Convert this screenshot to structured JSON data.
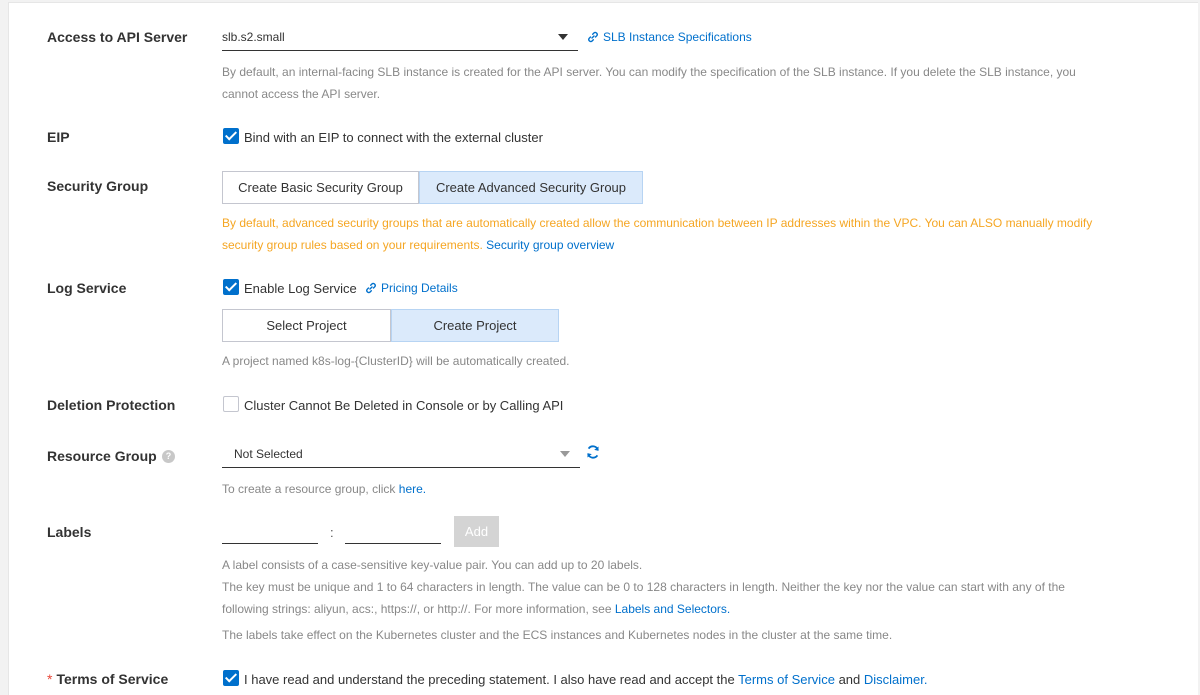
{
  "api_server": {
    "label": "Access to API Server",
    "select_value": "slb.s2.small",
    "spec_link": "SLB Instance Specifications",
    "help_line1": "By default, an internal-facing SLB instance is created for the API server. You can modify the specification of the SLB instance. If you delete the SLB instance, you",
    "help_line2": "cannot access the API server."
  },
  "eip": {
    "label": "EIP",
    "checked": true,
    "checkbox_label": "Bind with an EIP to connect with the external cluster"
  },
  "security_group": {
    "label": "Security Group",
    "basic_button": "Create Basic Security Group",
    "advanced_button": "Create Advanced Security Group",
    "warn_line1": "By default, advanced security groups that are automatically created allow the communication between IP addresses within the VPC. You can ALSO manually modify",
    "warn_line2": "security group rules based on your requirements.",
    "overview_link": "Security group overview"
  },
  "log_service": {
    "label": "Log Service",
    "checked": true,
    "checkbox_label": "Enable Log Service",
    "pricing_link": "Pricing Details",
    "select_project_button": "Select Project",
    "create_project_button": "Create Project",
    "help": "A project named k8s-log-{ClusterID} will be automatically created."
  },
  "deletion_protection": {
    "label": "Deletion Protection",
    "checked": false,
    "checkbox_label": "Cluster Cannot Be Deleted in Console or by Calling API"
  },
  "resource_group": {
    "label": "Resource Group",
    "select_value": "Not Selected",
    "help_prefix": "To create a resource group, click",
    "help_link": "here."
  },
  "labels": {
    "label": "Labels",
    "separator": ":",
    "add_button": "Add",
    "help_line1": "A label consists of a case-sensitive key-value pair. You can add up to 20 labels.",
    "help_line2": "The key must be unique and 1 to 64 characters in length. The value can be 0 to 128 characters in length. Neither the key nor the value can start with any of the",
    "help_line3": "following strings: aliyun, acs:, https://, or http://. For more information, see",
    "help_line3_link": "Labels and Selectors.",
    "help_line4": "The labels take effect on the Kubernetes cluster and the ECS instances and Kubernetes nodes in the cluster at the same time."
  },
  "terms": {
    "required_mark": "*",
    "label": "Terms of Service",
    "checked": true,
    "text_prefix": "I have read and understand the preceding statement. I also have read and accept the",
    "terms_link": "Terms of Service",
    "and": "and",
    "disclaimer_link": "Disclaimer."
  },
  "colors": {
    "link": "#0070cc",
    "warning": "#f5a623",
    "selected_button_bg": "#dbeafb",
    "checkbox_checked": "#0070cc"
  },
  "icons": [
    "link-icon",
    "caret-down-icon",
    "checkmark-icon",
    "help-circle-icon",
    "refresh-icon"
  ]
}
